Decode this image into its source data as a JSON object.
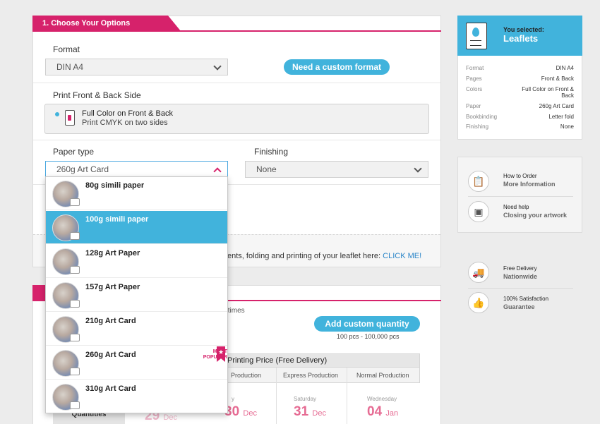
{
  "options": {
    "section_title": "1. Choose Your Options",
    "format_label": "Format",
    "format_value": "DIN A4",
    "custom_format_button": "Need a custom format",
    "print_label": "Print Front & Back Side",
    "print_option_title": "Full Color on Front & Back",
    "print_option_sub": "Print CMYK on two sides",
    "paper_label": "Paper type",
    "paper_value": "260g Art Card",
    "finishing_label": "Finishing",
    "finishing_value": "None",
    "info_text": "ents, folding and printing of your leaflet here: ",
    "info_link": "CLICK ME!"
  },
  "paper_dropdown": {
    "items": [
      {
        "label": "80g simili paper"
      },
      {
        "label": "100g simili paper"
      },
      {
        "label": "128g Art Paper"
      },
      {
        "label": "157g Art Paper"
      },
      {
        "label": "210g Art Card"
      },
      {
        "label": "260g Art Card"
      },
      {
        "label": "310g Art Card"
      }
    ],
    "selected_index": 1,
    "popular_badge": "MOST POPULAR",
    "popular_star": "★"
  },
  "quantity": {
    "times_fragment": "y times",
    "custom_quantity_button": "Add custom quantity",
    "range": "100 pcs - 100,000 pcs",
    "price_header": "Printing Price (Free Delivery)",
    "col1": "Production",
    "col2": "Express Production",
    "col3": "Normal Production",
    "day1": "y",
    "date1_num": "30",
    "date1_mon": "Dec",
    "day2": "Saturday",
    "date2_num": "31",
    "date2_mon": "Dec",
    "day3": "Wednesday",
    "date3_num": "04",
    "date3_mon": "Jan",
    "partial_date_num": "29",
    "partial_date_mon": "Dec",
    "quantities_tab": "Quantities"
  },
  "summary": {
    "heading": "You selected:",
    "product": "Leaflets",
    "rows": [
      {
        "key": "Format",
        "value": "DIN A4"
      },
      {
        "key": "Pages",
        "value": "Front & Back"
      },
      {
        "key": "Colors",
        "value": "Full Color on Front &"
      },
      {
        "key": "",
        "value": "Back"
      },
      {
        "key": "Paper",
        "value": "260g Art Card"
      },
      {
        "key": "Bookbinding",
        "value": "Letter fold"
      },
      {
        "key": "Finishing",
        "value": "None"
      }
    ]
  },
  "help": {
    "order_t1": "How to Order",
    "order_t2": "More Information",
    "help_t1": "Need help",
    "help_t2": "Closing your artwork",
    "delivery_t1": "Free Delivery",
    "delivery_t2": "Nationwide",
    "satisfaction_t1": "100% Satisfaction",
    "satisfaction_t2": "Guarantee"
  },
  "colors": {
    "accent_pink": "#d6226b",
    "accent_blue": "#41b3dc"
  }
}
